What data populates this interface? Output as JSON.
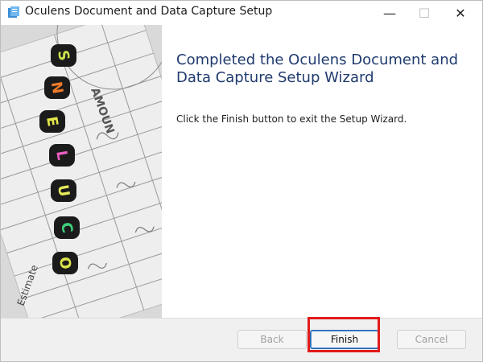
{
  "window": {
    "title": "Oculens Document and Data Capture Setup",
    "controls": {
      "minimize": "—",
      "maximize": "☐",
      "close": "✕"
    }
  },
  "image_panel": {
    "letter_beads": [
      "S",
      "N",
      "E",
      "L",
      "U",
      "C",
      "O"
    ],
    "paper_text": [
      "AMOUN",
      "Estimate"
    ]
  },
  "content": {
    "heading": "Completed the Oculens Document and Data Capture Setup Wizard",
    "message": "Click the Finish button to exit the Setup Wizard."
  },
  "buttons": {
    "back": "Back",
    "finish": "Finish",
    "cancel": "Cancel"
  },
  "colors": {
    "heading": "#1f3a6e",
    "highlight": "#e21a1a",
    "footer_bg": "#f0f0f0"
  }
}
